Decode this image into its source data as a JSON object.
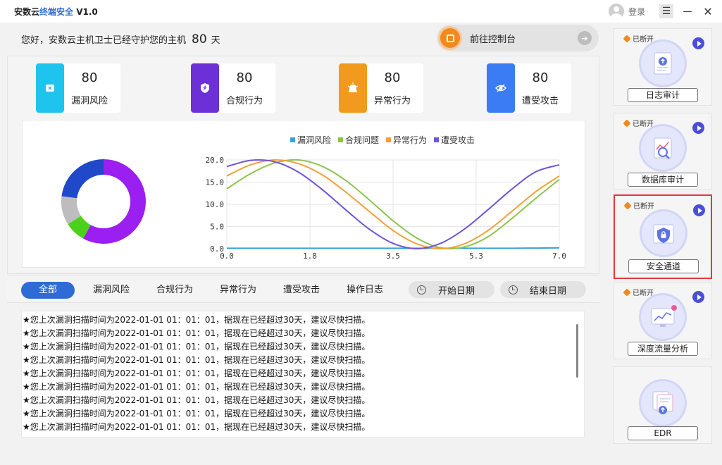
{
  "app": {
    "title_prefix": "安数云",
    "title_accent": "终端安全",
    "title_version": "V1.0",
    "login": "登录"
  },
  "header": {
    "greeting": "您好，安数云主机卫士已经守护您的主机",
    "days": "80",
    "days_unit": "天",
    "console_label": "前往控制台"
  },
  "stats": [
    {
      "value": "80",
      "label": "漏洞风险",
      "color": "#1fc4ee"
    },
    {
      "value": "80",
      "label": "合规行为",
      "color": "#6d30d6"
    },
    {
      "value": "80",
      "label": "异常行为",
      "color": "#f29a1e"
    },
    {
      "value": "80",
      "label": "遭受攻击",
      "color": "#3b7cf5"
    }
  ],
  "chart_data": [
    {
      "type": "pie",
      "donut": true,
      "labels": [],
      "values": [
        58,
        8,
        11,
        23
      ],
      "colors": [
        "#9b1ff0",
        "#4cd11a",
        "#bdbdbd",
        "#1f49c9"
      ]
    },
    {
      "type": "line",
      "legend": [
        {
          "name": "漏洞风险",
          "color": "#3aa0d8"
        },
        {
          "name": "合规问题",
          "color": "#8dc44e"
        },
        {
          "name": "异常行为",
          "color": "#f0a13a"
        },
        {
          "name": "遭受攻击",
          "color": "#7053d6"
        }
      ],
      "x_ticks": [
        "0.0",
        "1.8",
        "3.5",
        "5.3",
        "7.0"
      ],
      "y_ticks": [
        "0.0",
        "5.0",
        "10.0",
        "15.0",
        "20.0"
      ],
      "xlim": [
        0,
        7
      ],
      "ylim": [
        0,
        20
      ],
      "series": [
        {
          "name": "漏洞风险",
          "x": [
            0,
            1,
            2,
            3,
            4,
            5,
            6,
            7
          ],
          "y": [
            0.1,
            0.1,
            0.1,
            0.1,
            0.1,
            0.1,
            0.1,
            0.2
          ]
        },
        {
          "name": "合规问题",
          "x": [
            0,
            0.5,
            1,
            1.5,
            2,
            2.5,
            3,
            3.5,
            4,
            4.5,
            5,
            5.5,
            6,
            6.5,
            7
          ],
          "y": [
            13.5,
            16.9,
            19.3,
            20.0,
            18.6,
            15.4,
            11.0,
            6.3,
            2.4,
            0.2,
            0.4,
            2.7,
            6.8,
            11.3,
            15.6
          ]
        },
        {
          "name": "异常行为",
          "x": [
            0,
            0.5,
            1,
            1.5,
            2,
            2.5,
            3,
            3.5,
            4,
            4.5,
            5,
            5.5,
            6,
            6.5,
            7
          ],
          "y": [
            16.4,
            18.9,
            20.0,
            19.2,
            16.7,
            12.8,
            8.4,
            4.1,
            1.1,
            0.0,
            1.1,
            4.1,
            8.4,
            12.8,
            16.4
          ]
        },
        {
          "name": "遭受攻击",
          "x": [
            0,
            0.5,
            1,
            1.5,
            2,
            2.5,
            3,
            3.5,
            4,
            4.5,
            5,
            5.5,
            6,
            6.5,
            7
          ],
          "y": [
            18.5,
            19.9,
            19.6,
            17.3,
            13.4,
            8.8,
            4.4,
            1.2,
            0.0,
            1.2,
            4.4,
            8.8,
            13.4,
            17.3,
            18.9
          ]
        }
      ]
    }
  ],
  "tabs": [
    "全部",
    "漏洞风险",
    "合规行为",
    "异常行为",
    "遭受攻击",
    "操作日志"
  ],
  "dates": {
    "start": "开始日期",
    "end": "结束日期"
  },
  "logs": [
    "★您上次漏洞扫描时间为2022-01-01 01：01：01，据现在已经超过30天，建议尽快扫描。",
    "★您上次漏洞扫描时间为2022-01-01 01：01：01，据现在已经超过30天，建议尽快扫描。",
    "★您上次漏洞扫描时间为2022-01-01 01：01：01，据现在已经超过30天，建议尽快扫描。",
    "★您上次漏洞扫描时间为2022-01-01 01：01：01，据现在已经超过30天，建议尽快扫描。",
    "★您上次漏洞扫描时间为2022-01-01 01：01：01，据现在已经超过30天，建议尽快扫描。",
    "★您上次漏洞扫描时间为2022-01-01 01：01：01，据现在已经超过30天，建议尽快扫描。",
    "★您上次漏洞扫描时间为2022-01-01 01：01：01，据现在已经超过30天，建议尽快扫描。",
    "★您上次漏洞扫描时间为2022-01-01 01：01：01，据现在已经超过30天，建议尽快扫描。",
    "★您上次漏洞扫描时间为2022-01-01 01：01：01，据现在已经超过30天，建议尽快扫描。"
  ],
  "sidebar": [
    {
      "status": "已断开",
      "label": "日志审计",
      "icon": "log-audit-icon",
      "show_status": true
    },
    {
      "status": "已断开",
      "label": "数据库审计",
      "icon": "database-audit-icon",
      "show_status": true
    },
    {
      "status": "已断开",
      "label": "安全通道",
      "icon": "secure-channel-icon",
      "show_status": true,
      "selected": true
    },
    {
      "status": "已断开",
      "label": "深度流量分析",
      "icon": "traffic-analysis-icon",
      "show_status": true
    },
    {
      "status": "",
      "label": "EDR",
      "icon": "edr-icon",
      "show_status": false
    }
  ]
}
